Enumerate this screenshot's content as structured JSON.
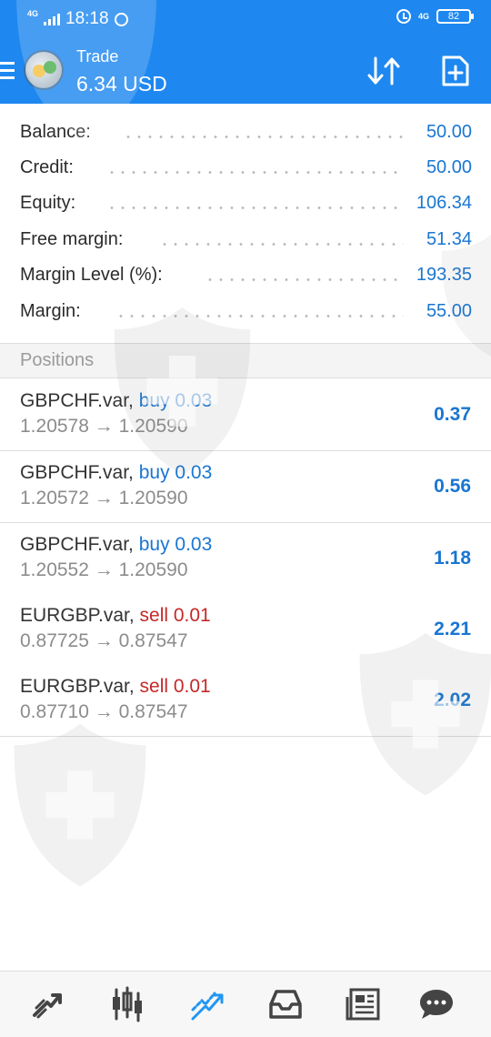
{
  "status_bar": {
    "network_left": "4G",
    "time": "18:18",
    "network_right": "4G",
    "battery": "82"
  },
  "header": {
    "title": "Trade",
    "profit": "6.34 USD",
    "bg_color": "#1e88f0"
  },
  "account": [
    {
      "label": "Balance:",
      "value": "50.00"
    },
    {
      "label": "Credit:",
      "value": "50.00"
    },
    {
      "label": "Equity:",
      "value": "106.34"
    },
    {
      "label": "Free margin:",
      "value": "51.34"
    },
    {
      "label": "Margin Level (%):",
      "value": "193.35"
    },
    {
      "label": "Margin:",
      "value": "55.00"
    }
  ],
  "positions": {
    "title": "Positions",
    "items": [
      {
        "symbol": "GBPCHF.var,",
        "side": "buy 0.03",
        "open": "1.20578",
        "arrow": "→",
        "current": "1.20590",
        "profit": "0.37"
      },
      {
        "symbol": "GBPCHF.var,",
        "side": "buy 0.03",
        "open": "1.20572",
        "arrow": "→",
        "current": "1.20590",
        "profit": "0.56"
      },
      {
        "symbol": "GBPCHF.var,",
        "side": "buy 0.03",
        "open": "1.20552",
        "arrow": "→",
        "current": "1.20590",
        "profit": "1.18"
      },
      {
        "symbol": "EURGBP.var,",
        "side": "sell 0.01",
        "open": "0.87725",
        "arrow": "→",
        "current": "0.87547",
        "profit": "2.21"
      },
      {
        "symbol": "EURGBP.var,",
        "side": "sell 0.01",
        "open": "0.87710",
        "arrow": "→",
        "current": "0.87547",
        "profit": "2.02"
      }
    ]
  },
  "colors": {
    "accent": "#1976d2",
    "buy": "#1976d2",
    "sell": "#c62828",
    "active_nav": "#2196f3"
  },
  "bottom_nav": [
    {
      "name": "quotes-icon"
    },
    {
      "name": "chart-icon"
    },
    {
      "name": "trade-icon",
      "active": true
    },
    {
      "name": "history-icon"
    },
    {
      "name": "news-icon"
    },
    {
      "name": "chat-icon"
    }
  ]
}
